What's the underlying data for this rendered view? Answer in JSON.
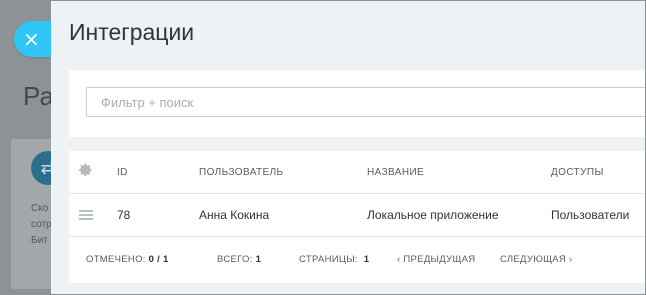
{
  "background": {
    "title": "Ра",
    "card_icon": "transfer-arrows-icon",
    "card_lines": [
      "Ско",
      "сотр",
      "Бит"
    ]
  },
  "close_button": {
    "icon": "close-icon",
    "glyph": "×"
  },
  "panel": {
    "title": "Интеграции"
  },
  "filter": {
    "placeholder": "Фильтр + поиск",
    "value": ""
  },
  "grid": {
    "settings_icon": "gear-icon",
    "columns": {
      "id": "ID",
      "user": "ПОЛЬЗОВАТЕЛЬ",
      "name": "НАЗВАНИЕ",
      "access": "ДОСТУПЫ"
    },
    "rows": [
      {
        "id": "78",
        "user": "Анна Кокина",
        "name": "Локальное приложение",
        "access": "Пользователи"
      }
    ]
  },
  "footer": {
    "selected_label": "ОТМЕЧЕНО:",
    "selected_value": "0 / 1",
    "total_label": "ВСЕГО:",
    "total_value": "1",
    "pages_label": "СТРАНИЦЫ:",
    "pages_value": "1",
    "prev": "ПРЕДЫДУЩАЯ",
    "next": "СЛЕДУЮЩАЯ"
  },
  "colors": {
    "accent": "#2fc6f6",
    "panel_bg": "#eef2f4",
    "overlay": "#8d9297"
  }
}
